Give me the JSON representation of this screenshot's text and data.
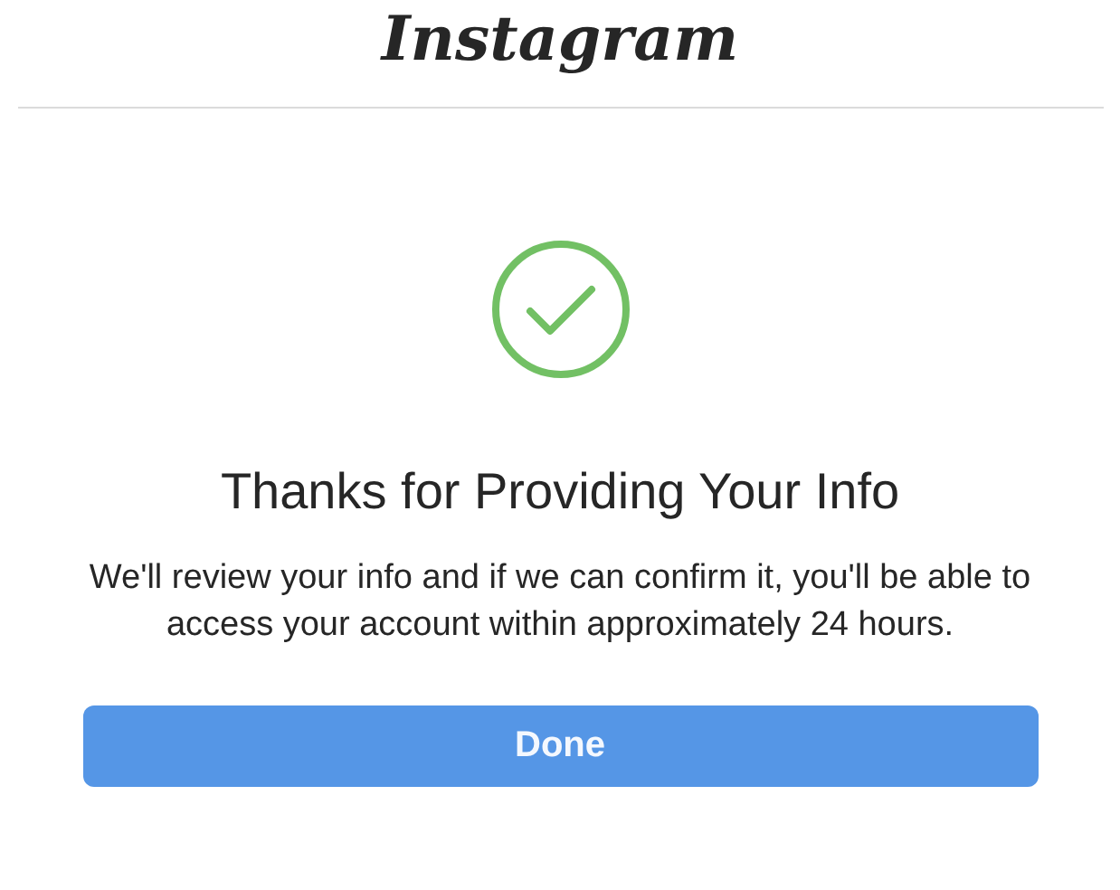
{
  "header": {
    "logo": "Instagram"
  },
  "status": {
    "kind": "success",
    "title": "Thanks for Providing Your Info",
    "message": "We'll review your info and if we can confirm it, you'll be able to access your account within approximately 24 hours."
  },
  "buttons": [
    {
      "label": "Done",
      "kind": "primary"
    }
  ]
}
